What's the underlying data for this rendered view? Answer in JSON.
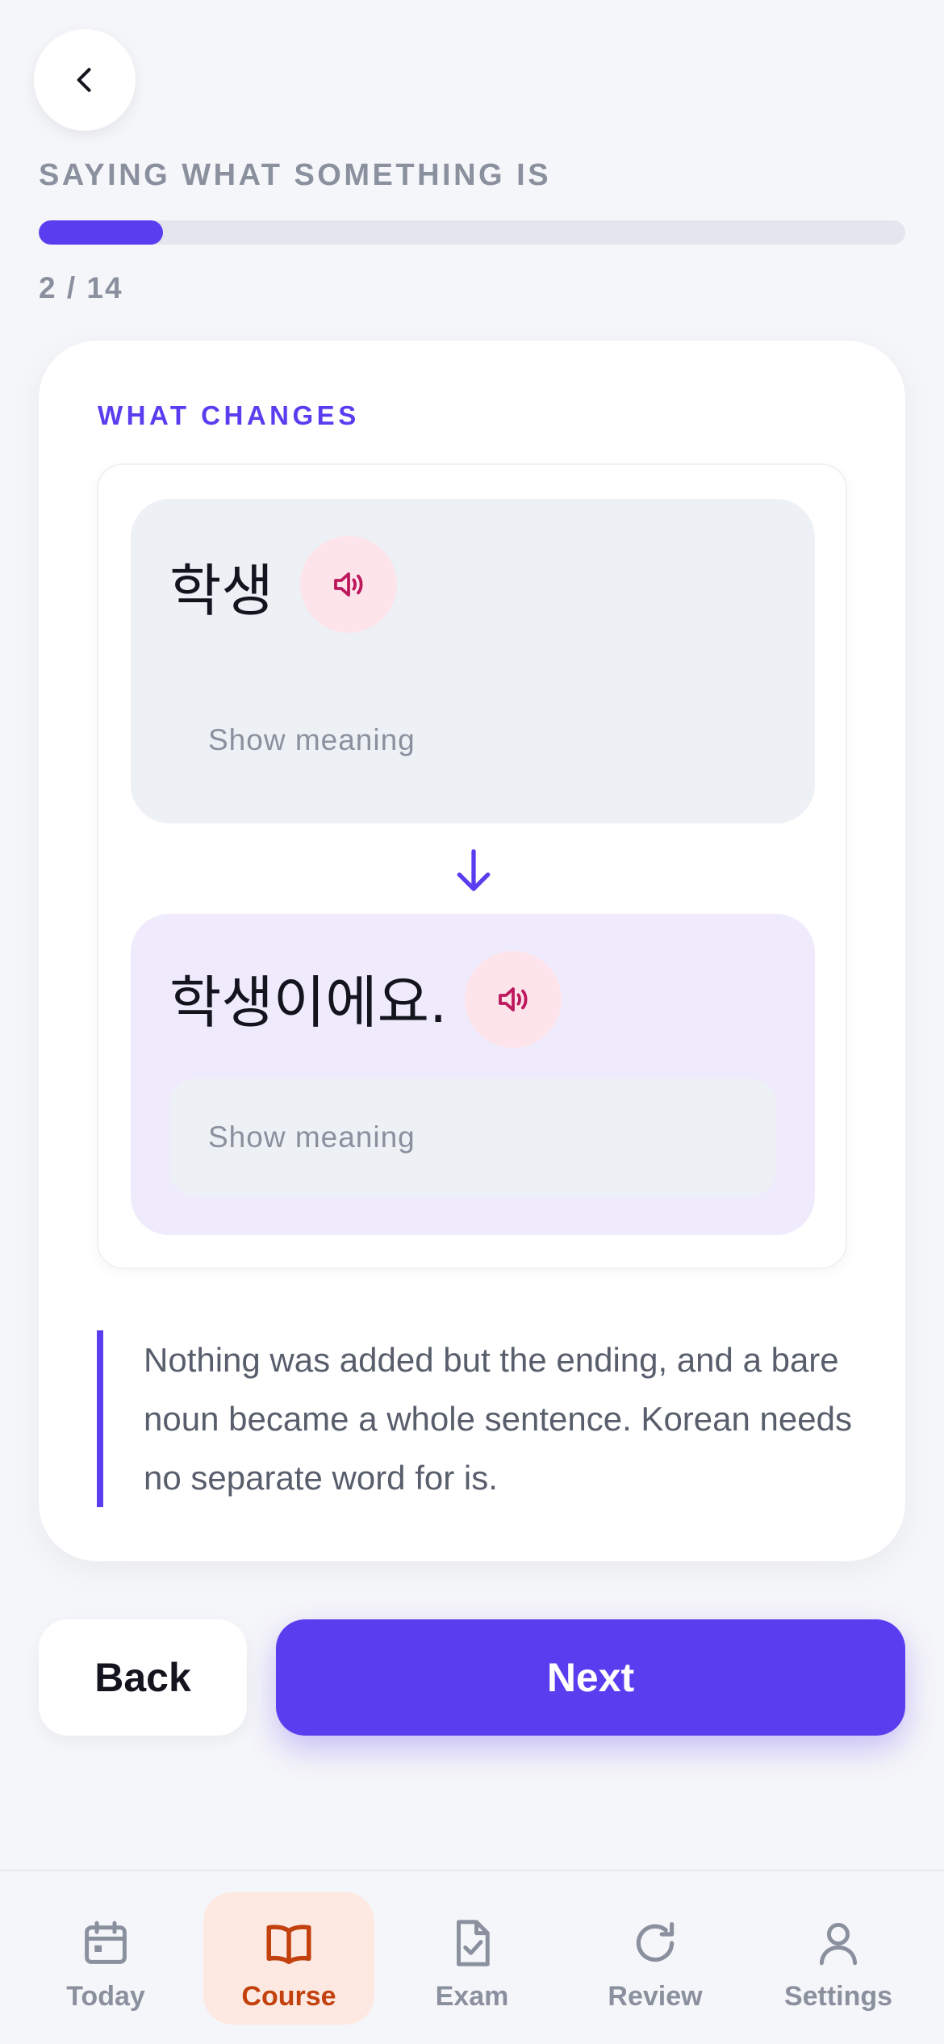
{
  "lesson": {
    "title": "SAYING WHAT SOMETHING IS",
    "progress_text": "2 / 14",
    "progress_fraction": 0.143
  },
  "card": {
    "section_label": "WHAT CHANGES",
    "base_word": {
      "text": "학생",
      "meaning_label": "Show meaning"
    },
    "result_word": {
      "text": "학생이에요.",
      "meaning_label": "Show meaning"
    },
    "note": "Nothing was added but the ending, and a bare noun became a whole sentence. Korean needs no separate word for is."
  },
  "actions": {
    "back_label": "Back",
    "next_label": "Next"
  },
  "tabbar": {
    "items": [
      {
        "label": "Today",
        "icon": "calendar-icon"
      },
      {
        "label": "Course",
        "icon": "book-icon",
        "active": true
      },
      {
        "label": "Exam",
        "icon": "document-check-icon"
      },
      {
        "label": "Review",
        "icon": "refresh-icon"
      },
      {
        "label": "Settings",
        "icon": "user-icon"
      }
    ]
  },
  "colors": {
    "accent": "#5b3df0",
    "active_tab": "#c2410c",
    "audio": "#be185d"
  }
}
